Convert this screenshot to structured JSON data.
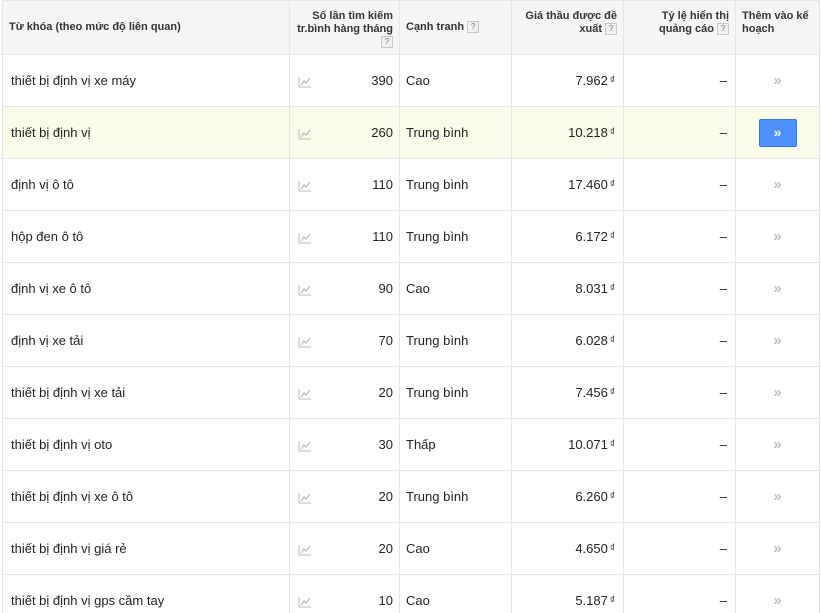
{
  "table": {
    "headers": {
      "keyword": "Từ khóa (theo mức độ liên quan)",
      "searches_line1": "Số lần tìm kiếm",
      "searches_line2": "tr.bình hàng tháng",
      "competition": "Cạnh tranh",
      "bid_line1": "Giá thầu được đề",
      "bid_line2": "xuất",
      "share_line1": "Tỷ lệ hiển thị",
      "share_line2": "quảng cáo",
      "add_line1": "Thêm vào kế",
      "add_line2": "hoạch",
      "help": "?"
    },
    "currency": "₫",
    "rows": [
      {
        "keyword": "thiết bị định vị xe máy",
        "searches": "390",
        "competition": "Cao",
        "bid": "7.962",
        "share": "–",
        "add": "»"
      },
      {
        "keyword": "thiết bị định vị",
        "searches": "260",
        "competition": "Trung bình",
        "bid": "10.218",
        "share": "–",
        "add": "»"
      },
      {
        "keyword": "định vị ô tô",
        "searches": "110",
        "competition": "Trung bình",
        "bid": "17.460",
        "share": "–",
        "add": "»"
      },
      {
        "keyword": "hộp đen ô tô",
        "searches": "110",
        "competition": "Trung bình",
        "bid": "6.172",
        "share": "–",
        "add": "»"
      },
      {
        "keyword": "định vị xe ô tô",
        "searches": "90",
        "competition": "Cao",
        "bid": "8.031",
        "share": "–",
        "add": "»"
      },
      {
        "keyword": "định vị xe tải",
        "searches": "70",
        "competition": "Trung bình",
        "bid": "6.028",
        "share": "–",
        "add": "»"
      },
      {
        "keyword": "thiết bị định vị xe tải",
        "searches": "20",
        "competition": "Trung bình",
        "bid": "7.456",
        "share": "–",
        "add": "»"
      },
      {
        "keyword": "thiết bị định vị oto",
        "searches": "30",
        "competition": "Thấp",
        "bid": "10.071",
        "share": "–",
        "add": "»"
      },
      {
        "keyword": "thiết bị định vị xe ô tô",
        "searches": "20",
        "competition": "Trung bình",
        "bid": "6.260",
        "share": "–",
        "add": "»"
      },
      {
        "keyword": "thiết bị định vị giá rẻ",
        "searches": "20",
        "competition": "Cao",
        "bid": "4.650",
        "share": "–",
        "add": "»"
      },
      {
        "keyword": "thiết bị định vị gps cầm tay",
        "searches": "10",
        "competition": "Cao",
        "bid": "5.187",
        "share": "–",
        "add": "»"
      }
    ],
    "highlighted_row": 1,
    "icons": {
      "trend": "line-chart-icon"
    },
    "colors": {
      "highlight_bg": "#fbfbe9",
      "button_blue": "#4d90fe",
      "header_bg": "#f5f5f5"
    }
  }
}
